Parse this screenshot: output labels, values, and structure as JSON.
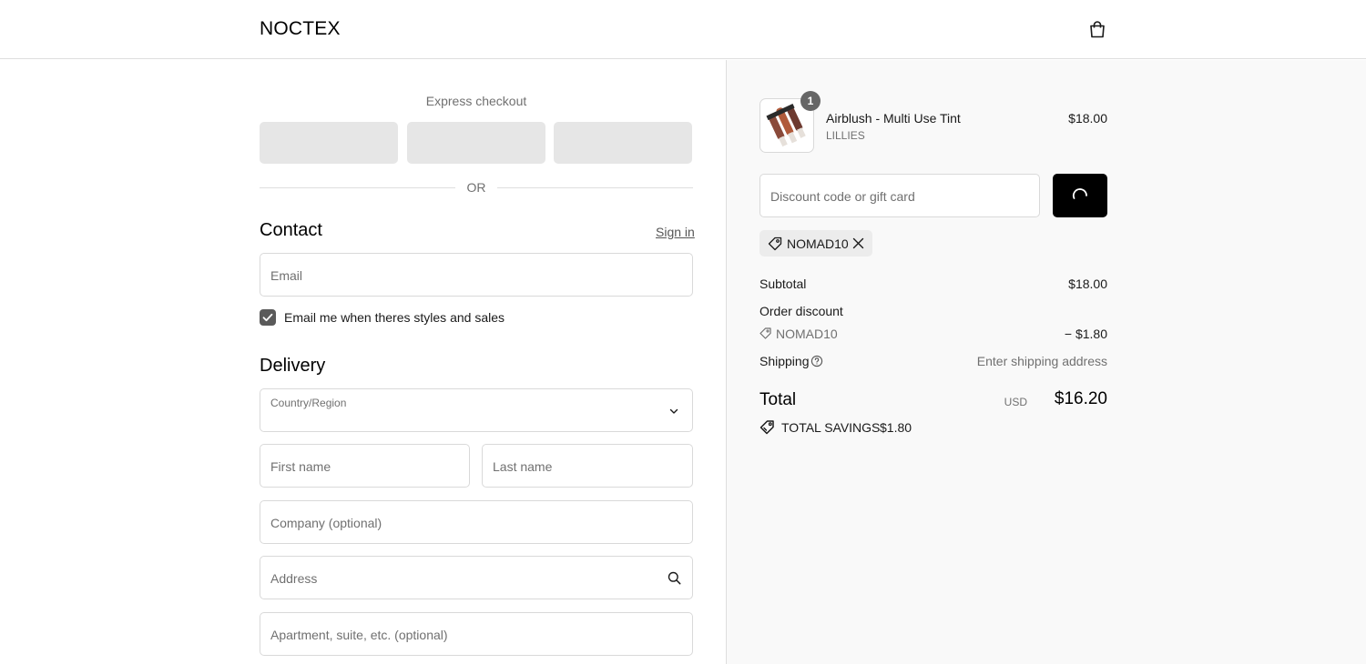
{
  "header": {
    "logo": "NOCTEX",
    "cart_icon": "shopping-bag-icon"
  },
  "express": {
    "label": "Express checkout",
    "buttons": 3,
    "or_text": "OR"
  },
  "contact": {
    "title": "Contact",
    "sign_in": "Sign in",
    "email_placeholder": "Email",
    "marketing_label": "Email me when theres styles and sales",
    "marketing_checked": true
  },
  "delivery": {
    "title": "Delivery",
    "country_label": "Country/Region",
    "country_value": "",
    "first_name_placeholder": "First name",
    "last_name_placeholder": "Last name",
    "company_placeholder": "Company (optional)",
    "address_placeholder": "Address",
    "apartment_placeholder": "Apartment, suite, etc. (optional)"
  },
  "summary": {
    "item": {
      "name": "Airblush - Multi Use Tint",
      "variant": "LILLIES",
      "price": "$18.00",
      "quantity": "1"
    },
    "discount_placeholder": "Discount code or gift card",
    "applied_code": "NOMAD10",
    "subtotal_label": "Subtotal",
    "subtotal_value": "$18.00",
    "order_discount_label": "Order discount",
    "discount_code": "NOMAD10",
    "discount_value": "− $1.80",
    "shipping_label": "Shipping",
    "shipping_value": "Enter shipping address",
    "total_label": "Total",
    "total_currency": "USD",
    "total_value": "$16.20",
    "savings_label": "TOTAL SAVINGS",
    "savings_value": "$1.80"
  },
  "colors": {
    "button_dark": "#000000",
    "express_placeholder": "#e6e6e6",
    "summary_bg": "#f9f9f9",
    "checkbox": "#5a5a5a"
  }
}
